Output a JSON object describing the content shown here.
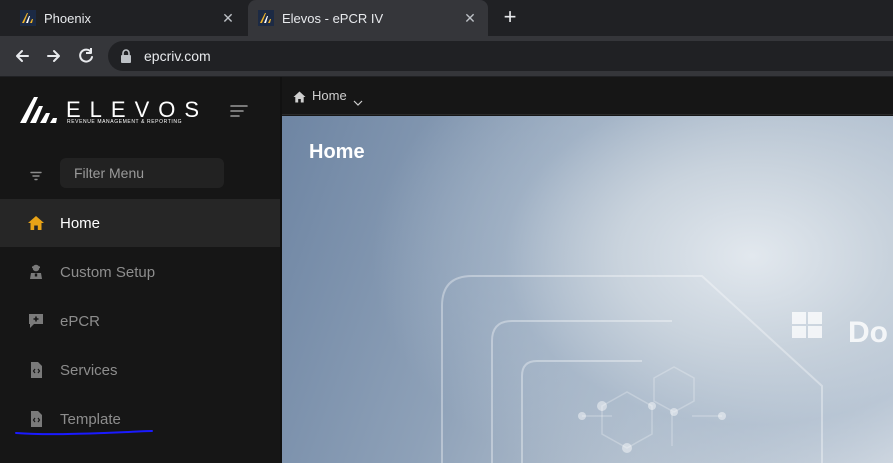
{
  "browser": {
    "tabs": [
      {
        "title": "Phoenix",
        "active": false
      },
      {
        "title": "Elevos - ePCR IV",
        "active": true
      }
    ],
    "url": "epcriv.com"
  },
  "app": {
    "brand": {
      "name": "ELEVOS",
      "tagline": "REVENUE MANAGEMENT & REPORTING"
    },
    "filter": {
      "placeholder": "Filter Menu"
    },
    "menu": [
      {
        "label": "Home",
        "icon": "home-icon",
        "active": true
      },
      {
        "label": "Custom Setup",
        "icon": "custom-setup-icon",
        "active": false
      },
      {
        "label": "ePCR",
        "icon": "epcr-icon",
        "active": false
      },
      {
        "label": "Services",
        "icon": "code-file-icon",
        "active": false
      },
      {
        "label": "Template",
        "icon": "code-file-icon",
        "active": false
      }
    ],
    "breadcrumb": {
      "label": "Home"
    },
    "page": {
      "title": "Home",
      "background_text": "Do"
    },
    "colors": {
      "accent": "#e8a317",
      "sidebar_bg": "#161616",
      "active_item_bg": "#262626"
    }
  }
}
